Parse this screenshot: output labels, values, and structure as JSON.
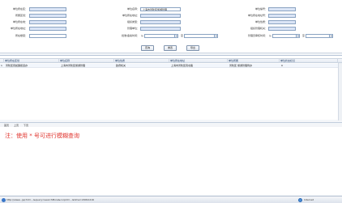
{
  "form": {
    "row1": {
      "c1_label": "单位所在区：",
      "c2_label": "单位名称：",
      "c2_value": "上海市普陀区旅游管理",
      "c3_label": "单位编号："
    },
    "row2": {
      "c1_label": "所属区划：",
      "c2_label": "单位所在地址：",
      "c3_label": "单位所在地址号："
    },
    "row3": {
      "c1_label": "单位所在地：",
      "c2_label": "组织类型：",
      "c3_label": "单位性质："
    },
    "row4": {
      "c1_label": "单位所在地址：",
      "c2_label": "管理单位：",
      "c3_label": "组织管理机关："
    },
    "row5": {
      "c1_label": "所在楼层：",
      "c2_label": "批准/备案时间：",
      "c2_from": "从",
      "c2_to": "至",
      "c3_label": "管理员审核时间：",
      "c3_from": "从",
      "c3_to": "至"
    },
    "buttons": {
      "search": "查询",
      "reset": "重置",
      "export": "导出"
    }
  },
  "grid": {
    "columns": [
      "单位所在区划",
      "单位名称",
      "单位性质",
      "单位所在地址",
      "单位所属",
      "单位状态标识"
    ],
    "rows": [
      {
        "index": "1",
        "cells": [
          "普陀区真如镇街道办",
          "上海市普陀区旅游管理",
          "政府机关",
          "上海市普陀区真北路",
          "普陀区 旅游管理局办",
          "0"
        ]
      }
    ]
  },
  "pager": {
    "first": "首页",
    "prev": "上页",
    "next": "下页"
  },
  "tip": "注：使用 * 号可进行模糊查询",
  "statusbar": {
    "text": "http://www...jsp?id=...&query=searchMore&corpId=...&time=20091216",
    "zone": "Internet"
  }
}
